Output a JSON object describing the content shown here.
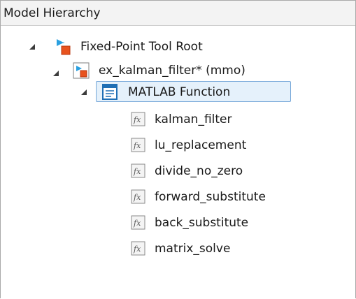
{
  "header": {
    "title": "Model Hierarchy"
  },
  "tree": {
    "root": {
      "label": "Fixed-Point Tool Root",
      "icon": "model-root-icon"
    },
    "model": {
      "label": "ex_kalman_filter* (mmo)",
      "icon": "simulink-model-icon"
    },
    "block": {
      "label": "MATLAB Function",
      "icon": "matlab-function-block-icon"
    },
    "functions": [
      {
        "label": "kalman_filter",
        "icon": "fx-icon"
      },
      {
        "label": "lu_replacement",
        "icon": "fx-icon"
      },
      {
        "label": "divide_no_zero",
        "icon": "fx-icon"
      },
      {
        "label": "forward_substitute",
        "icon": "fx-icon"
      },
      {
        "label": "back_substitute",
        "icon": "fx-icon"
      },
      {
        "label": "matrix_solve",
        "icon": "fx-icon"
      }
    ]
  },
  "colors": {
    "selection_bg": "#e5f1fb",
    "selection_border": "#77a8d9",
    "header_bg": "#f3f3f3"
  }
}
